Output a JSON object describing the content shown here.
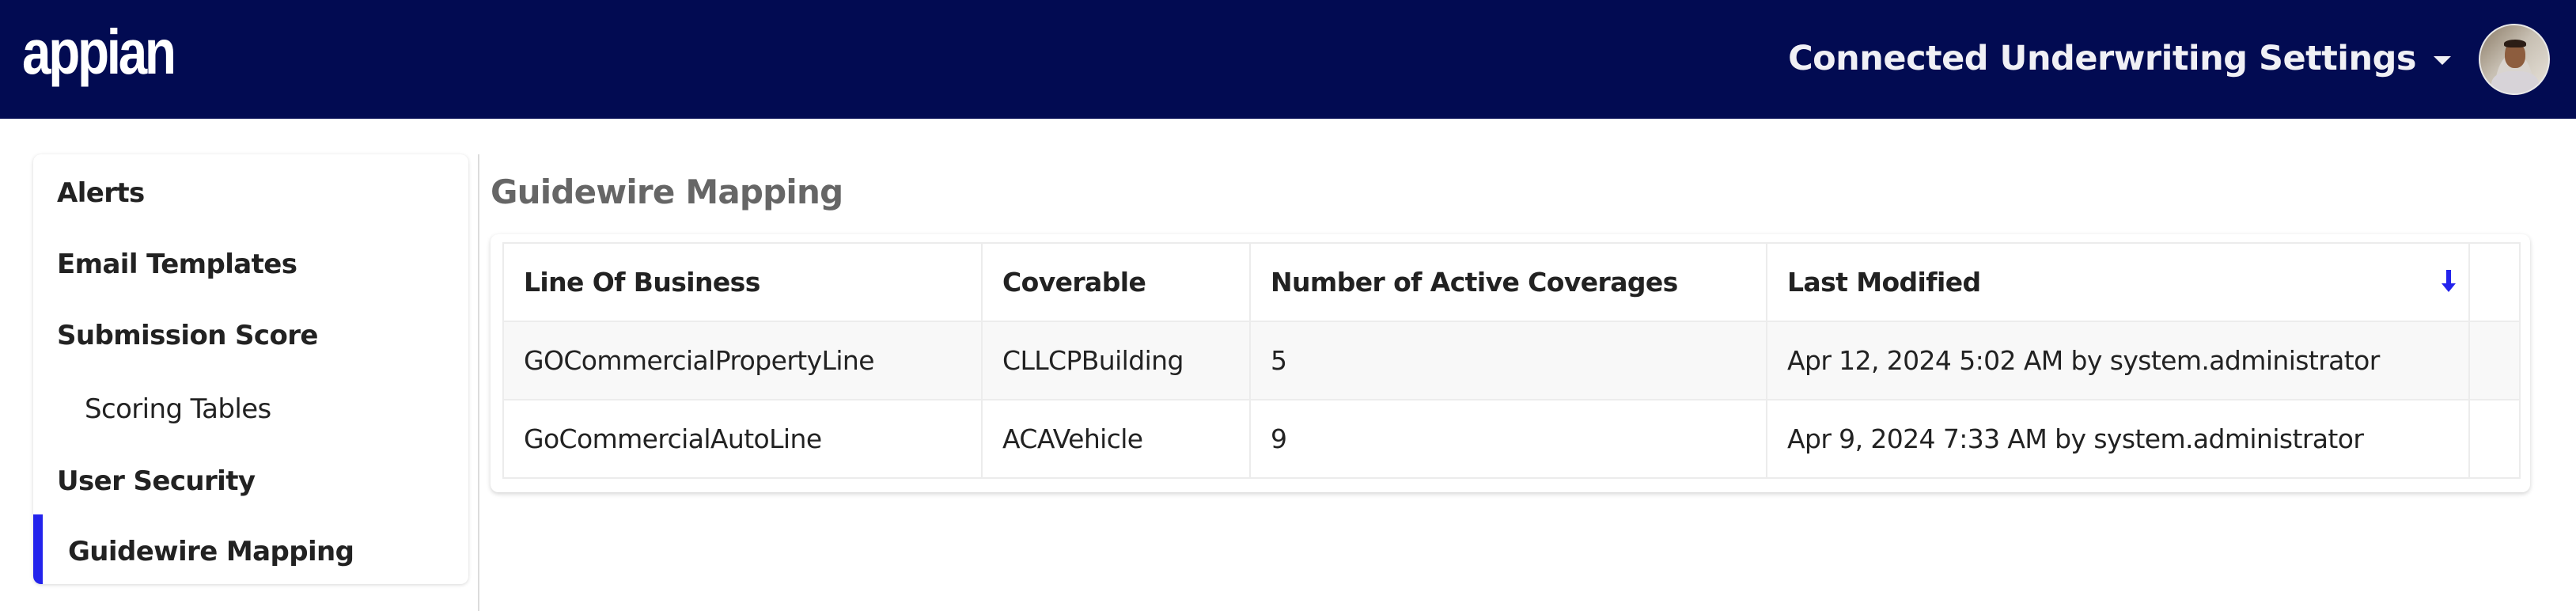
{
  "header": {
    "logo_text": "appian",
    "app_title": "Connected Underwriting Settings",
    "menu_icon": "caret-down-icon",
    "avatar_icon": "user-avatar"
  },
  "sidebar": {
    "items": [
      {
        "label": "Alerts",
        "level": 1,
        "active": false
      },
      {
        "label": "Email Templates",
        "level": 1,
        "active": false
      },
      {
        "label": "Submission Score",
        "level": 1,
        "active": false
      },
      {
        "label": "Scoring Tables",
        "level": 2,
        "active": false
      },
      {
        "label": "User Security",
        "level": 1,
        "active": false
      },
      {
        "label": "Guidewire Mapping",
        "level": 1,
        "active": true
      }
    ],
    "active_color": "#2323EC"
  },
  "main": {
    "title": "Guidewire Mapping",
    "grid": {
      "columns": [
        {
          "label": "Line Of Business"
        },
        {
          "label": "Coverable"
        },
        {
          "label": "Number of Active Coverages"
        },
        {
          "label": "Last Modified",
          "sort": "descending",
          "sort_icon": "arrow-down-icon"
        },
        {
          "label": ""
        }
      ],
      "rows": [
        [
          "GOCommercialPropertyLine",
          "CLLCPBuilding",
          "5",
          "Apr 12, 2024 5:02 AM by system.administrator",
          ""
        ],
        [
          "GoCommercialAutoLine",
          "ACAVehicle",
          "9",
          "Apr 9, 2024 7:33 AM by system.administrator",
          ""
        ]
      ]
    }
  },
  "colors": {
    "header_bg": "#020B52",
    "accent": "#2323EC",
    "title": "#666666"
  }
}
